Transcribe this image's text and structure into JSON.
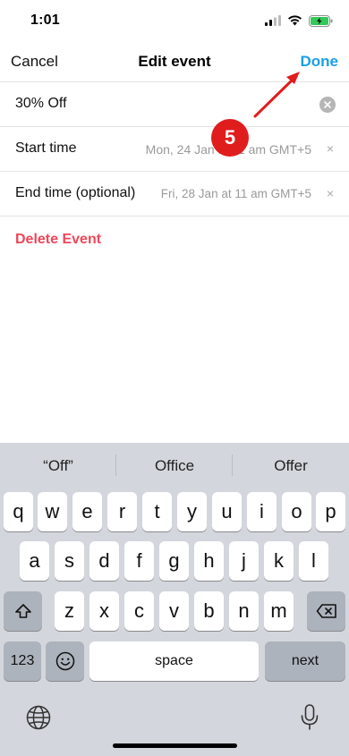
{
  "status": {
    "time": "1:01"
  },
  "nav": {
    "cancel": "Cancel",
    "title": "Edit event",
    "done": "Done"
  },
  "form": {
    "name_value": "30% Off",
    "start_label": "Start time",
    "start_value": "Mon, 24 Jan at 11 am GMT+5",
    "end_label": "End time (optional)",
    "end_value": "Fri, 28 Jan at 11 am GMT+5",
    "clear_glyph": "×",
    "delete_label": "Delete Event"
  },
  "annotation": {
    "step": "5"
  },
  "keyboard": {
    "suggestions": [
      "“Off”",
      "Office",
      "Offer"
    ],
    "row1": [
      "q",
      "w",
      "e",
      "r",
      "t",
      "y",
      "u",
      "i",
      "o",
      "p"
    ],
    "row2": [
      "a",
      "s",
      "d",
      "f",
      "g",
      "h",
      "j",
      "k",
      "l"
    ],
    "row3": [
      "z",
      "x",
      "c",
      "v",
      "b",
      "n",
      "m"
    ],
    "numbers_label": "123",
    "space_label": "space",
    "next_label": "next",
    "icons": [
      "shift-icon",
      "delete-icon",
      "emoji-icon",
      "globe-icon",
      "microphone-icon"
    ]
  },
  "colors": {
    "accent": "#1a9ee6",
    "destructive": "#f0475a",
    "annotation": "#e01d1d",
    "keyboard_bg": "#d3d6dc"
  }
}
